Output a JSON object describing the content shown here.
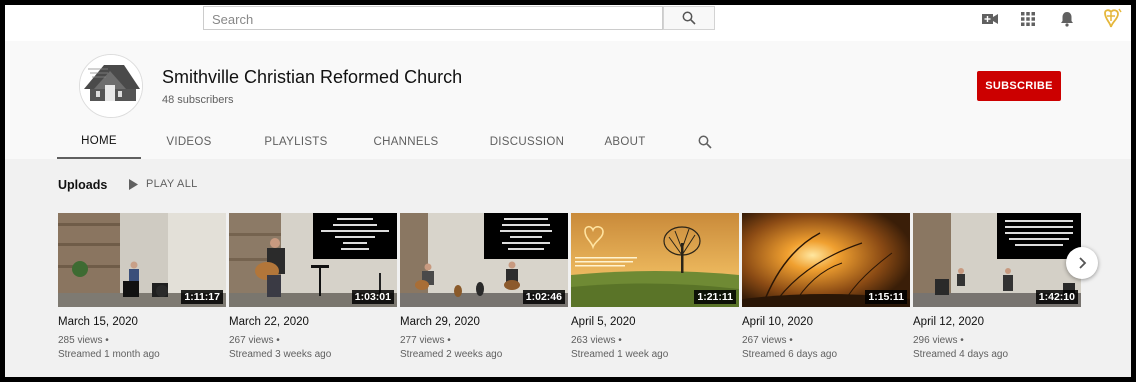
{
  "search": {
    "placeholder": "Search"
  },
  "channel": {
    "name": "Smithville Christian Reformed Church",
    "subscribers": "48 subscribers",
    "subscribe_label": "SUBSCRIBE"
  },
  "tabs": [
    {
      "label": "HOME"
    },
    {
      "label": "VIDEOS"
    },
    {
      "label": "PLAYLISTS"
    },
    {
      "label": "CHANNELS"
    },
    {
      "label": "DISCUSSION"
    },
    {
      "label": "ABOUT"
    }
  ],
  "uploads": {
    "title": "Uploads",
    "play_all": "PLAY ALL"
  },
  "videos": [
    {
      "title": "March 15, 2020",
      "views": "285 views",
      "streamed": "Streamed 1 month ago",
      "duration": "1:11:17"
    },
    {
      "title": "March 22, 2020",
      "views": "267 views",
      "streamed": "Streamed 3 weeks ago",
      "duration": "1:03:01"
    },
    {
      "title": "March 29, 2020",
      "views": "277 views",
      "streamed": "Streamed 2 weeks ago",
      "duration": "1:02:46"
    },
    {
      "title": "April 5, 2020",
      "views": "263 views",
      "streamed": "Streamed 1 week ago",
      "duration": "1:21:11"
    },
    {
      "title": "April 10, 2020",
      "views": "267 views",
      "streamed": "Streamed 6 days ago",
      "duration": "1:15:11"
    },
    {
      "title": "April 12, 2020",
      "views": "296 views",
      "streamed": "Streamed 4 days ago",
      "duration": "1:42:10"
    }
  ],
  "icons": {
    "search": "search-icon",
    "create": "video-camera-icon",
    "apps": "apps-grid-icon",
    "notifications": "bell-icon",
    "account": "account-avatar-icon",
    "play": "play-icon",
    "next": "chevron-right-icon"
  },
  "colors": {
    "subscribe": "#cc0000",
    "background": "#f9f9f9",
    "section": "#f1f1f1"
  }
}
